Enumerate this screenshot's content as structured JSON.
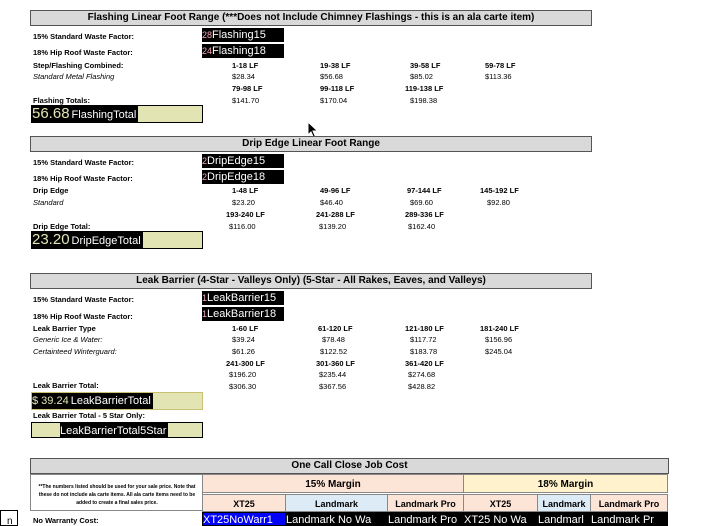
{
  "flashing": {
    "header": "Flashing Linear Foot Range  (***Does not Include Chimney Flashings - this is an ala carte item)",
    "std_label": "15% Standard Waste Factor:",
    "hip_label": "18% Hip Roof Waste Factor:",
    "std_field_num": "28",
    "std_field": "Flashing15",
    "hip_field_num": "24",
    "hip_field": "Flashing18",
    "type_label": "Step/Flashing Combined:",
    "type_sub": "Standard Metal Flashing",
    "ranges_row1": [
      "1-18 LF",
      "19-38 LF",
      "39-58 LF",
      "59-78 LF"
    ],
    "prices_row1": [
      "$28.34",
      "$56.68",
      "$85.02",
      "$113.36"
    ],
    "ranges_row2": [
      "79-98 LF",
      "99-118 LF",
      "119-138 LF"
    ],
    "prices_row2": [
      "$141.70",
      "$170.04",
      "$198.38"
    ],
    "totals_label": "Flashing Totals:",
    "total_value": "56.68",
    "total_name": "FlashingTotal"
  },
  "drip": {
    "header": "Drip Edge Linear Foot Range",
    "std_label": "15% Standard Waste Factor:",
    "hip_label": "18% Hip Roof Waste Factor:",
    "std_field_num": "2",
    "std_field": "DripEdge15",
    "hip_field_num": "2",
    "hip_field": "DripEdge18",
    "type_label": "Drip Edge",
    "type_sub": "Standard",
    "ranges_row1": [
      "1-48 LF",
      "49-96 LF",
      "97-144 LF",
      "145-192 LF"
    ],
    "prices_row1": [
      "$23.20",
      "$46.40",
      "$69.60",
      "$92.80"
    ],
    "ranges_row2": [
      "193-240 LF",
      "241-288 LF",
      "289-336 LF"
    ],
    "prices_row2": [
      "$116.00",
      "$139.20",
      "$162.40"
    ],
    "totals_label": "Drip Edge Total:",
    "total_value": "23.20",
    "total_name": "DripEdgeTotal"
  },
  "leak": {
    "header": "Leak Barrier (4-Star - Valleys Only)  (5-Star - All Rakes, Eaves, and Valleys)",
    "std_label": "15% Standard Waste Factor:",
    "hip_label": "18% Hip Roof Waste Factor:",
    "std_field_num": "1",
    "std_field": "LeakBarrier15",
    "hip_field_num": "1",
    "hip_field": "LeakBarrier18",
    "type_label": "Leak Barrier Type",
    "sub1": "Generic Ice & Water:",
    "sub2": "Certainteed Winterguard:",
    "ranges_row1": [
      "1-60 LF",
      "61-120 LF",
      "121-180 LF",
      "181-240 LF"
    ],
    "generic_row1": [
      "$39.24",
      "$78.48",
      "$117.72",
      "$156.96"
    ],
    "cert_row1": [
      "$61.26",
      "$122.52",
      "$183.78",
      "$245.04"
    ],
    "ranges_row2": [
      "241-300 LF",
      "301-360 LF",
      "361-420 LF"
    ],
    "generic_row2": [
      "$196.20",
      "$235.44",
      "$274.68"
    ],
    "cert_row2": [
      "$306.30",
      "$367.56",
      "$428.82"
    ],
    "total_label": "Leak Barrier Total:",
    "total_value": "$ 39.24",
    "total_name": "LeakBarrierTotal",
    "total5_label": "Leak Barrier Total - 5 Star Only:",
    "total5_name": "LeakBarrierTotal5Star"
  },
  "onecall": {
    "header": "One Call Close Job Cost",
    "note": "**The numbers listed should be used for your sale price. Note that these do not include ala carte items. All ala carte items need to be added to create a final sales price.",
    "margin15": "15% Margin",
    "margin18": "18% Margin",
    "cols": [
      "XT25",
      "Landmark",
      "Landmark Pro",
      "XT25",
      "Landmark",
      "Landmark Pro"
    ],
    "row_label": "No Warranty Cost:",
    "row_cells": [
      "XT25NoWarr1",
      "Landmark No Wa",
      "Landmark Pro",
      "XT25 No Wa",
      "Landmarl",
      "Landmark Pr"
    ]
  },
  "left_edge_label": "n",
  "colors": {
    "header_bg": "#d9d9d9",
    "total_bg": "#e3e4b4",
    "pink": "#e8a0b4",
    "margin15_bg": "#fce4d6",
    "margin18_bg": "#fff2cc",
    "landmark_bg": "#ddebf7",
    "selected_blue": "#0000ff"
  }
}
